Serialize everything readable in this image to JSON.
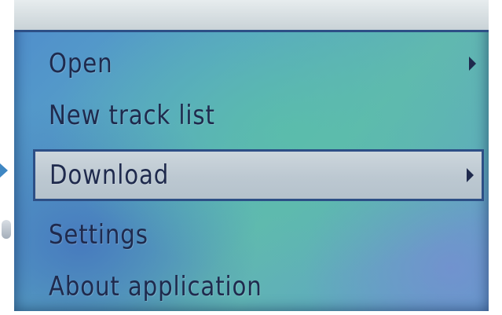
{
  "menu": {
    "items": [
      {
        "label": "Open",
        "has_submenu": true,
        "selected": false
      },
      {
        "label": "New track list",
        "has_submenu": false,
        "selected": false
      },
      {
        "label": "Download",
        "has_submenu": true,
        "selected": true
      },
      {
        "label": "Settings",
        "has_submenu": false,
        "selected": false
      },
      {
        "label": "About application",
        "has_submenu": false,
        "selected": false
      }
    ]
  },
  "icons": {
    "pointer": "selection-pointer-icon",
    "submenu": "chevron-right-icon"
  },
  "colors": {
    "screen_blue": "#4f8ccd",
    "screen_teal": "#61b8b0",
    "highlight": "#c4ced6",
    "highlight_border": "#2d4f86",
    "text": "#1f2a4d"
  }
}
